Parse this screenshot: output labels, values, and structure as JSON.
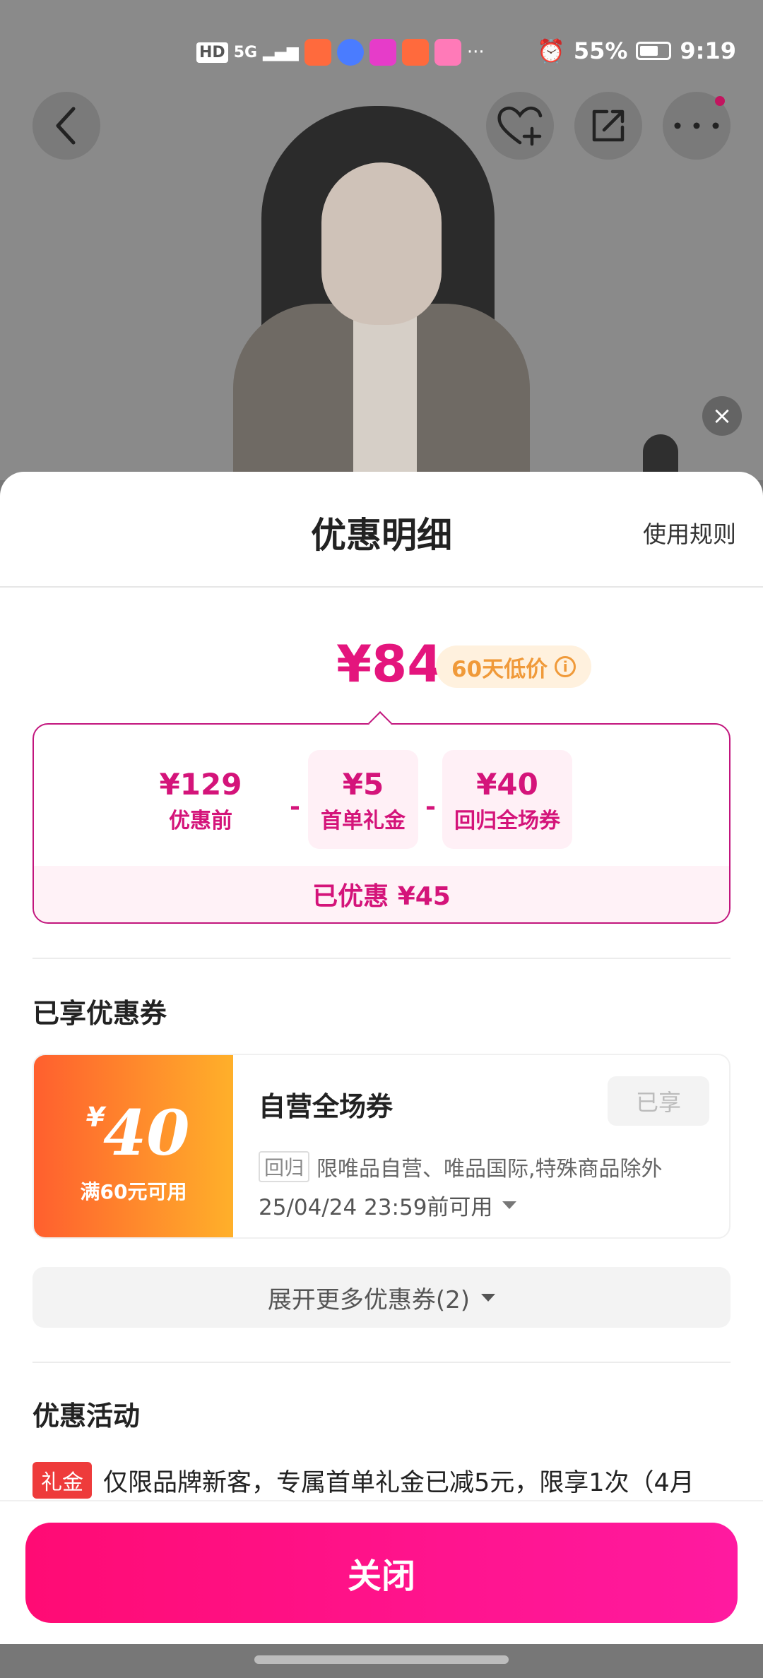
{
  "status_bar": {
    "time": "9:19",
    "battery": "55%",
    "network": "5G",
    "hd": "HD",
    "more": "···"
  },
  "product_nav": {
    "icons": [
      "back-icon",
      "favorite-add-icon",
      "share-icon",
      "more-icon"
    ]
  },
  "sheet": {
    "title": "优惠明细",
    "rules_label": "使用规则",
    "final_price": "¥84",
    "low_price_tag": "60天低价",
    "breakdown": [
      {
        "value": "¥129",
        "label": "优惠前"
      },
      {
        "value": "¥5",
        "label": "首单礼金"
      },
      {
        "value": "¥40",
        "label": "回归全场券"
      }
    ],
    "minus_sign": "-",
    "saved_text": "已优惠 ¥45",
    "coupons_section_title": "已享优惠券",
    "coupon": {
      "currency": "¥",
      "amount": "40",
      "condition": "满60元可用",
      "name": "自营全场券",
      "status": "已享",
      "tag": "回归",
      "scope": "限唯品自营、唯品国际,特殊商品除外",
      "expiry": "25/04/24 23:59前可用"
    },
    "expand_label": "展开更多优惠券(2)",
    "activity_section_title": "优惠活动",
    "activity": {
      "badge": "礼金",
      "text": "仅限品牌新客，专属首单礼金已减5元，限享1次（4月"
    },
    "close_label": "关闭"
  },
  "colors": {
    "accent": "#e4157d",
    "close_button": "#ff0b74",
    "low_tag_text": "#f09a3a",
    "coupon_gradient_start": "#ff5f2e",
    "coupon_gradient_end": "#ffb02a",
    "activity_badge": "#ee3b3b"
  }
}
